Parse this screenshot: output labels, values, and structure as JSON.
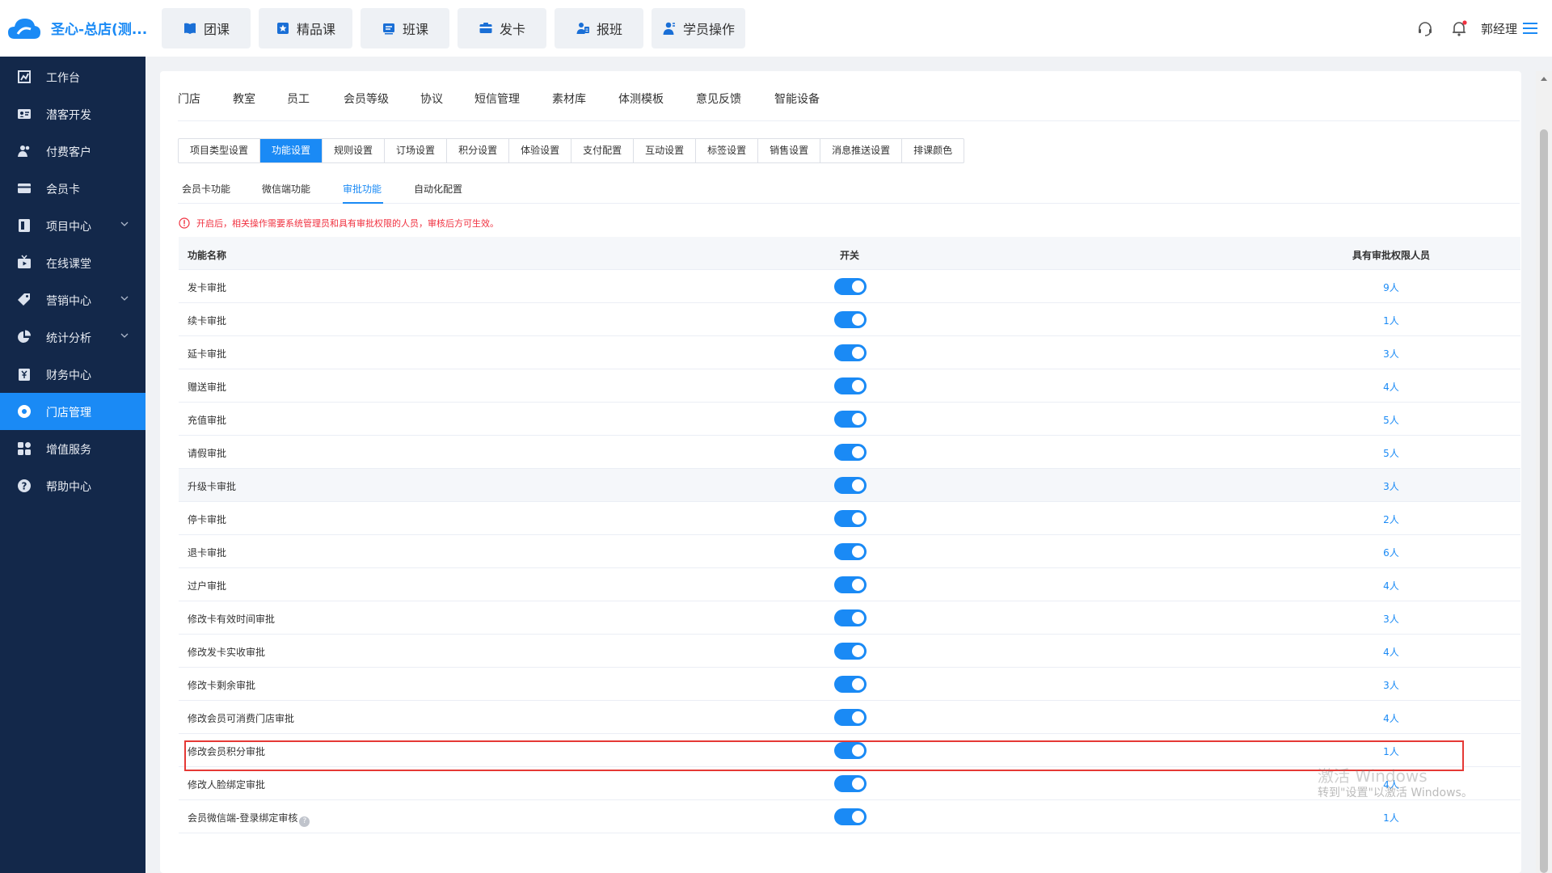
{
  "brand": {
    "name": "圣心-总店(测..."
  },
  "quick_actions": [
    {
      "label": "团课",
      "icon": "book-icon"
    },
    {
      "label": "精品课",
      "icon": "star-icon"
    },
    {
      "label": "班课",
      "icon": "list-icon"
    },
    {
      "label": "发卡",
      "icon": "card-icon"
    },
    {
      "label": "报班",
      "icon": "enroll-icon"
    },
    {
      "label": "学员操作",
      "icon": "user-icon"
    }
  ],
  "user": {
    "name": "郭经理"
  },
  "sidebar": {
    "items": [
      {
        "label": "工作台",
        "icon": "dashboard-icon",
        "expandable": false
      },
      {
        "label": "潜客开发",
        "icon": "id-card-icon",
        "expandable": false
      },
      {
        "label": "付费客户",
        "icon": "users-icon",
        "expandable": false
      },
      {
        "label": "会员卡",
        "icon": "card-icon",
        "expandable": false
      },
      {
        "label": "项目中心",
        "icon": "project-icon",
        "expandable": true
      },
      {
        "label": "在线课堂",
        "icon": "tv-icon",
        "expandable": false
      },
      {
        "label": "营销中心",
        "icon": "tag-icon",
        "expandable": true
      },
      {
        "label": "统计分析",
        "icon": "pie-chart-icon",
        "expandable": true
      },
      {
        "label": "财务中心",
        "icon": "finance-icon",
        "expandable": false
      },
      {
        "label": "门店管理",
        "icon": "store-icon",
        "expandable": false,
        "active": true
      },
      {
        "label": "增值服务",
        "icon": "apps-icon",
        "expandable": false
      },
      {
        "label": "帮助中心",
        "icon": "help-icon",
        "expandable": false
      }
    ]
  },
  "nav_level1": [
    "门店",
    "教室",
    "员工",
    "会员等级",
    "协议",
    "短信管理",
    "素材库",
    "体测模板",
    "意见反馈",
    "智能设备"
  ],
  "nav_level2": [
    "项目类型设置",
    "功能设置",
    "规则设置",
    "订场设置",
    "积分设置",
    "体验设置",
    "支付配置",
    "互动设置",
    "标签设置",
    "销售设置",
    "消息推送设置",
    "排课颜色"
  ],
  "nav_level2_active": 1,
  "nav_level3": [
    "会员卡功能",
    "微信端功能",
    "审批功能",
    "自动化配置"
  ],
  "nav_level3_active": 2,
  "notice": "开启后，相关操作需要系统管理员和具有审批权限的人员，审核后方可生效。",
  "table": {
    "headers": {
      "name": "功能名称",
      "switch": "开关",
      "people": "具有审批权限人员"
    },
    "rows": [
      {
        "name": "发卡审批",
        "enabled": true,
        "people": "9人"
      },
      {
        "name": "续卡审批",
        "enabled": true,
        "people": "1人"
      },
      {
        "name": "延卡审批",
        "enabled": true,
        "people": "3人"
      },
      {
        "name": "赠送审批",
        "enabled": true,
        "people": "4人"
      },
      {
        "name": "充值审批",
        "enabled": true,
        "people": "5人"
      },
      {
        "name": "请假审批",
        "enabled": true,
        "people": "5人"
      },
      {
        "name": "升级卡审批",
        "enabled": true,
        "people": "3人"
      },
      {
        "name": "停卡审批",
        "enabled": true,
        "people": "2人"
      },
      {
        "name": "退卡审批",
        "enabled": true,
        "people": "6人"
      },
      {
        "name": "过户审批",
        "enabled": true,
        "people": "4人"
      },
      {
        "name": "修改卡有效时间审批",
        "enabled": true,
        "people": "3人"
      },
      {
        "name": "修改发卡实收审批",
        "enabled": true,
        "people": "4人"
      },
      {
        "name": "修改卡剩余审批",
        "enabled": true,
        "people": "3人"
      },
      {
        "name": "修改会员可消费门店审批",
        "enabled": true,
        "people": "4人"
      },
      {
        "name": "修改会员积分审批",
        "enabled": true,
        "people": "1人"
      },
      {
        "name": "修改人脸绑定审批",
        "enabled": true,
        "people": "4人"
      },
      {
        "name": "会员微信端-登录绑定审核",
        "enabled": true,
        "people": "1人"
      }
    ]
  },
  "watermark": {
    "line1": "激活 Windows",
    "line2": "转到\"设置\"以激活 Windows。"
  },
  "colors": {
    "accent": "#1a8af5",
    "sidebar_bg": "#13284a",
    "warning": "#f0303f",
    "highlight": "#e53935"
  }
}
